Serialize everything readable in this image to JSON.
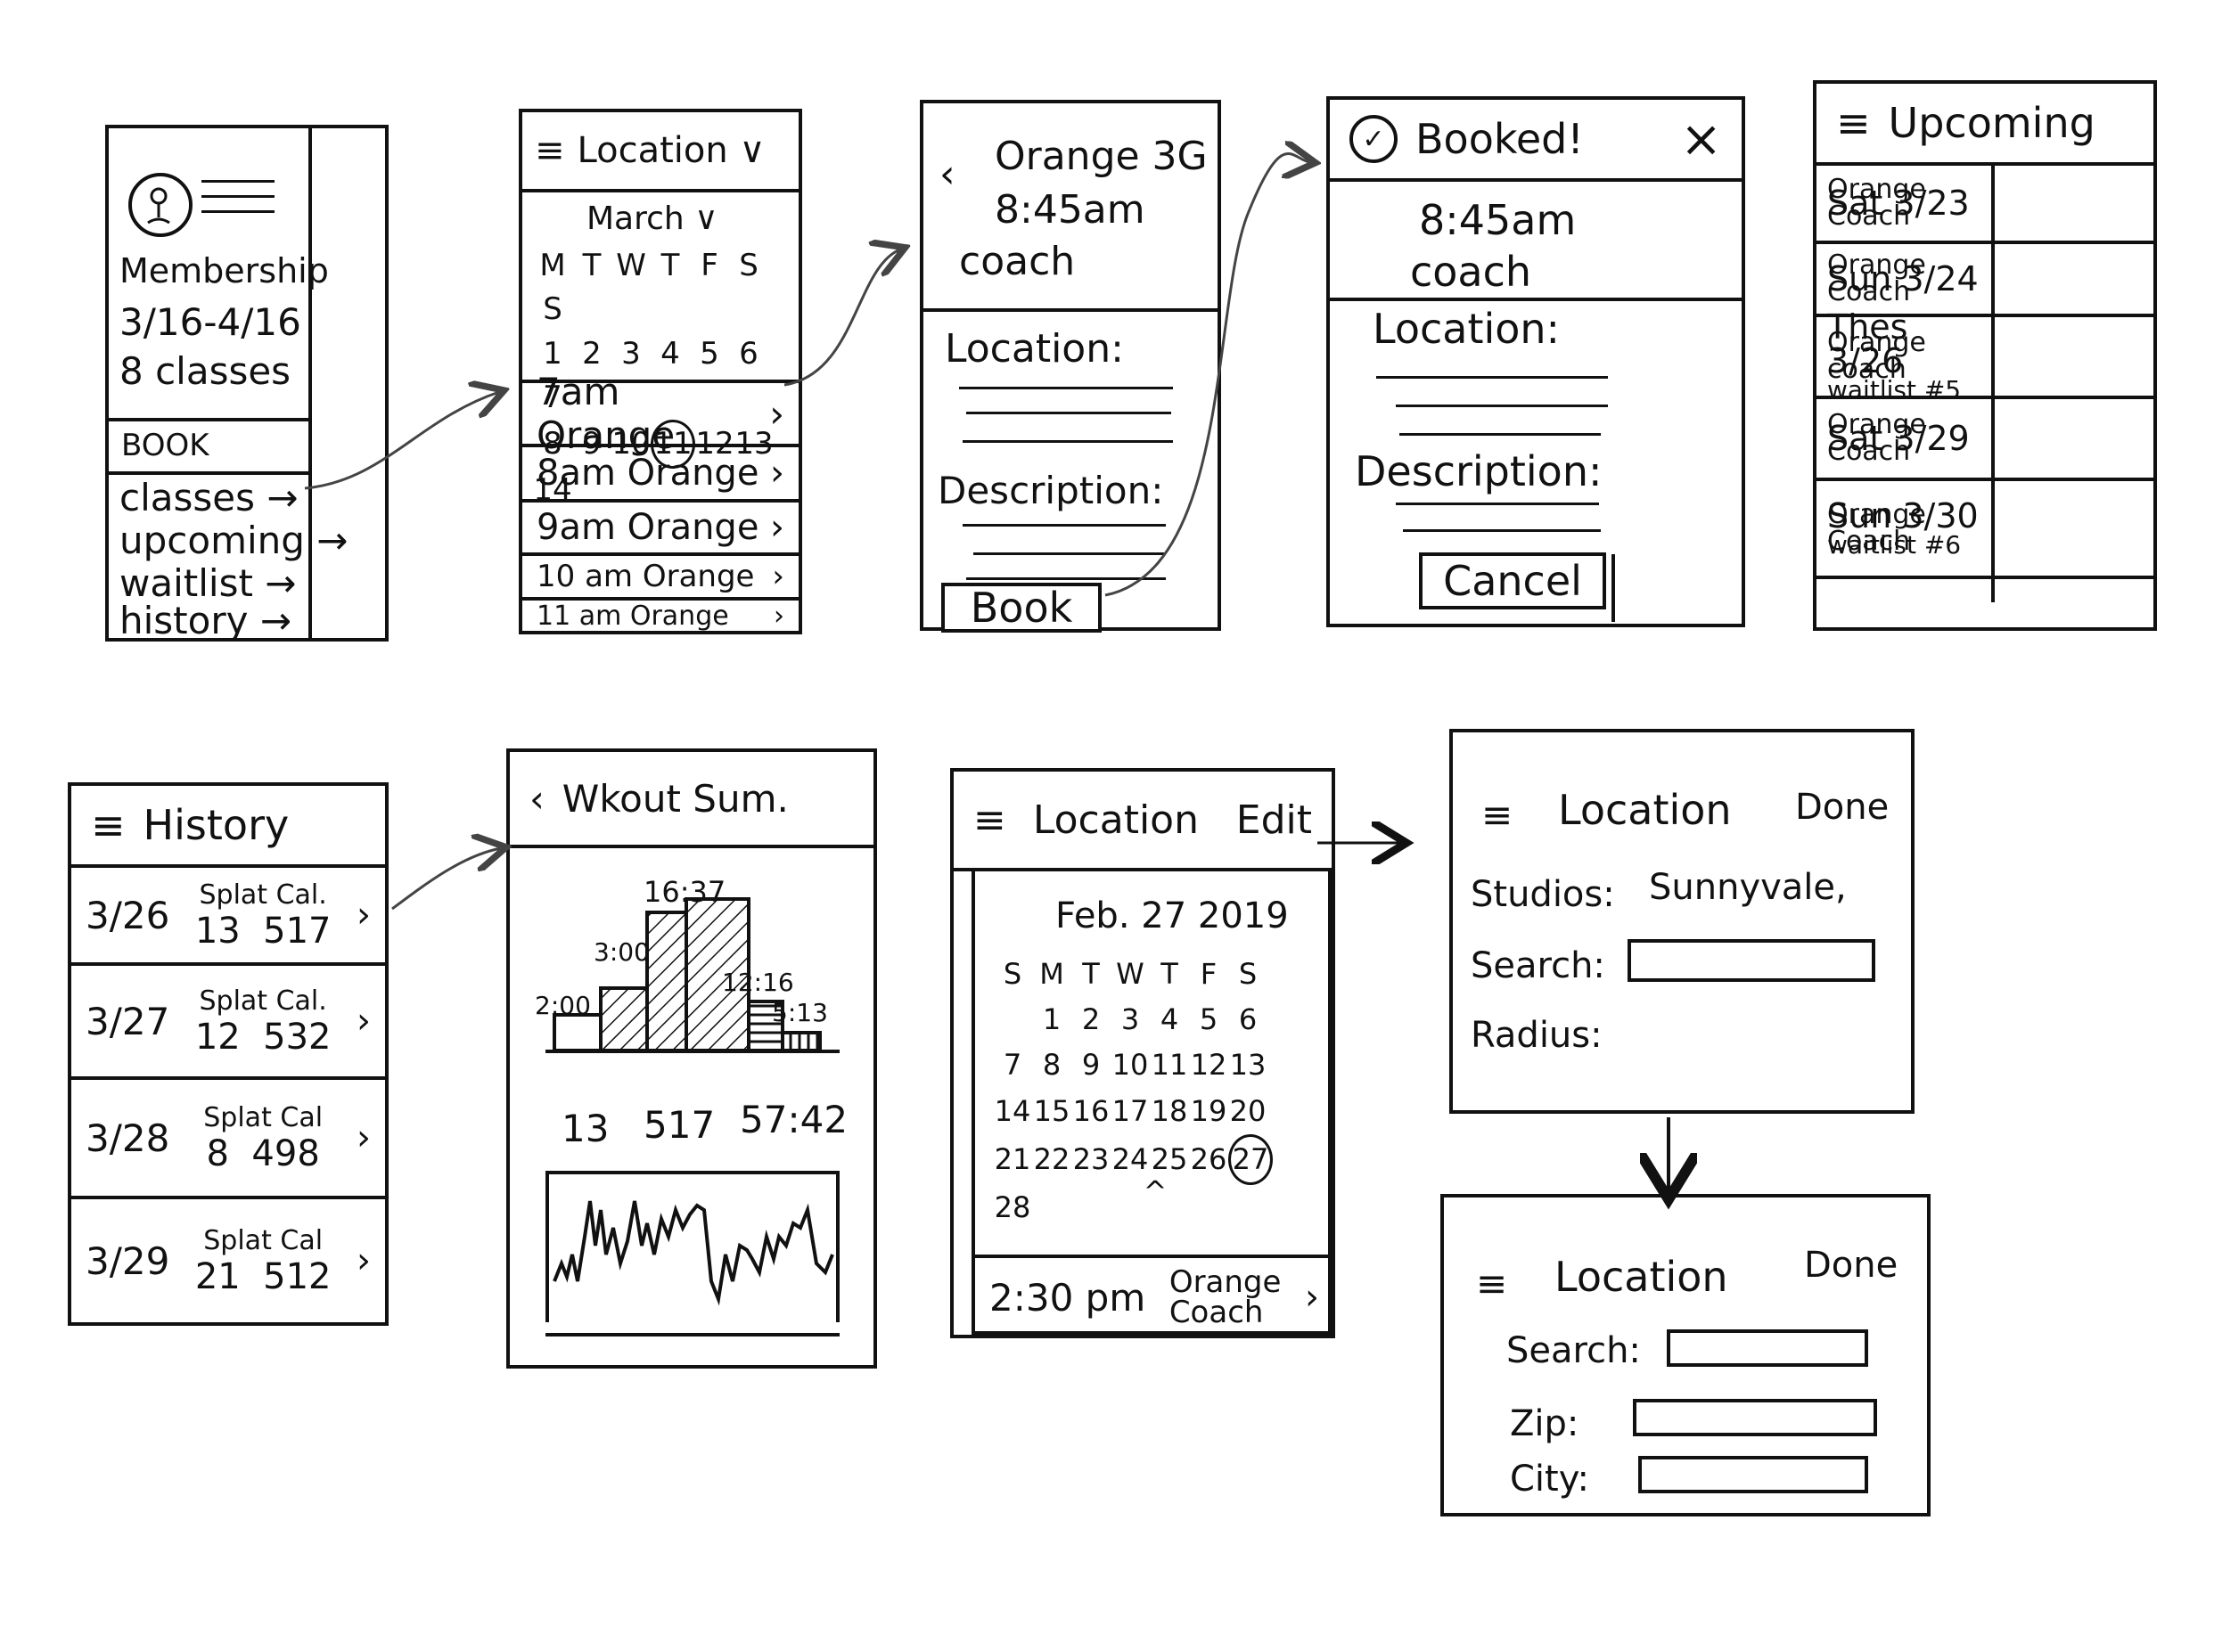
{
  "s1": {
    "membership_label": "Membership",
    "dates": "3/16-4/16",
    "classes_count": "8 classes",
    "book_label": "BOOK",
    "menu": [
      "classes",
      "upcoming",
      "waitlist",
      "history"
    ],
    "arrow": "→"
  },
  "s2": {
    "title": "Location",
    "month": "March",
    "weekdays": [
      "M",
      "T",
      "W",
      "T",
      "F",
      "S",
      "S"
    ],
    "week1": [
      "1",
      "2",
      "3",
      "4",
      "5",
      "6",
      "7"
    ],
    "week2": [
      "8",
      "9",
      "10",
      "11",
      "12",
      "13",
      "14"
    ],
    "selected_day": "11",
    "slots": [
      "7am Orange",
      "8am Orange",
      "9am Orange",
      "10 am Orange",
      "11 am Orange"
    ]
  },
  "s3": {
    "class_name": "Orange 3G",
    "time": "8:45am",
    "coach": "coach",
    "location_label": "Location:",
    "description_label": "Description:",
    "book_button": "Book"
  },
  "s4": {
    "title": "Booked!",
    "close": "×",
    "time": "8:45am",
    "coach": "coach",
    "location_label": "Location:",
    "description_label": "Description:",
    "cancel_button": "Cancel"
  },
  "s5": {
    "title": "Upcoming",
    "rows": [
      {
        "date": "Sat 3/23",
        "note": "",
        "cls": "Orange",
        "coach": "Coach"
      },
      {
        "date": "Sun 3/24",
        "note": "",
        "cls": "Orange",
        "coach": "Coach"
      },
      {
        "date": "Thes 3/26",
        "note": "waitlist #5",
        "cls": "Orange",
        "coach": "coach"
      },
      {
        "date": "Sat 3/29",
        "note": "",
        "cls": "Orange",
        "coach": "Coach"
      },
      {
        "date": "Sun 3/30",
        "note": "waitlist #6",
        "cls": "Orange",
        "coach": "Coach"
      }
    ]
  },
  "s6": {
    "title": "History",
    "rows": [
      {
        "date": "3/26",
        "labels": "Splat Cal.",
        "splat": "13",
        "cal": "517"
      },
      {
        "date": "3/27",
        "labels": "Splat Cal.",
        "splat": "12",
        "cal": "532"
      },
      {
        "date": "3/28",
        "labels": "Splat Cal",
        "splat": "8",
        "cal": "498"
      },
      {
        "date": "3/29",
        "labels": "Splat Cal",
        "splat": "21",
        "cal": "512"
      }
    ]
  },
  "s7": {
    "title": "Wkout Sum.",
    "bar_labels": [
      "2:00",
      "3:00",
      "16:37",
      "12:16",
      "5:13"
    ],
    "stats": [
      "13",
      "517",
      "57:42"
    ]
  },
  "s8": {
    "title": "Location",
    "edit": "Edit",
    "date": "Feb. 27 2019",
    "weekdays": [
      "S",
      "M",
      "T",
      "W",
      "T",
      "F",
      "S"
    ],
    "weeks": [
      [
        "",
        "",
        "",
        "",
        "",
        "",
        ""
      ],
      [
        "",
        "1",
        "2",
        "3",
        "4",
        "5",
        "6"
      ],
      [
        "7",
        "8",
        "9",
        "10",
        "11",
        "12",
        "13"
      ],
      [
        "14",
        "15",
        "16",
        "17",
        "18",
        "19",
        "20"
      ],
      [
        "21",
        "22",
        "23",
        "24",
        "25",
        "26",
        "27"
      ],
      [
        "28",
        "",
        "",
        "",
        "",
        "",
        ""
      ]
    ],
    "selected_day": "27",
    "collapse": "^",
    "session_time": "2:30 pm",
    "session_class": "Orange",
    "session_coach": "Coach"
  },
  "s9": {
    "title": "Location",
    "done": "Done",
    "studios_label": "Studios:",
    "studios_value": "Sunnyvale,",
    "search_label": "Search:",
    "radius_label": "Radius:"
  },
  "s10": {
    "title": "Location",
    "done": "Done",
    "search_label": "Search:",
    "zip_label": "Zip:",
    "city_label": "City:"
  }
}
